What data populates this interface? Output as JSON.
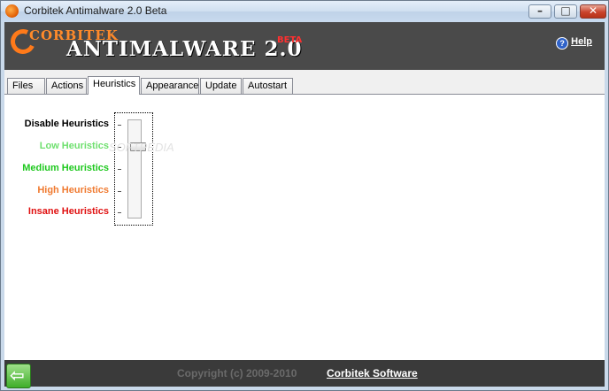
{
  "window": {
    "title": "Corbitek Antimalware 2.0 Beta",
    "minimize_glyph": "–",
    "maximize_glyph": "□",
    "close_glyph": "✕"
  },
  "banner": {
    "brand": "CORBITEK",
    "product": "ANTIMALWARE 2.0",
    "beta": "BETA",
    "help_label": "Help",
    "help_icon": "?"
  },
  "tabs": [
    {
      "label": "Files"
    },
    {
      "label": "Actions"
    },
    {
      "label": "Heuristics"
    },
    {
      "label": "Appearance"
    },
    {
      "label": "Update"
    },
    {
      "label": "Autostart"
    }
  ],
  "active_tab": "Heuristics",
  "heuristics": {
    "levels": [
      {
        "label": "Disable Heuristics",
        "color": "#000000"
      },
      {
        "label": "Low Heuristics",
        "color": "#6fe06f"
      },
      {
        "label": "Medium Heuristics",
        "color": "#1ec81e"
      },
      {
        "label": "High Heuristics",
        "color": "#f07a30"
      },
      {
        "label": "Insane Heuristics",
        "color": "#e01010"
      }
    ],
    "selected_level": "Low Heuristics",
    "watermark": "SOFTPEDIA"
  },
  "footer": {
    "back_arrow": "⇦",
    "copyright": "Copyright (c) 2009-2010",
    "company": "Corbitek Software"
  },
  "colors": {
    "brand_orange": "#ff8a2a",
    "chrome_dark": "#3a3a3a",
    "beta_red": "#ff3030"
  }
}
